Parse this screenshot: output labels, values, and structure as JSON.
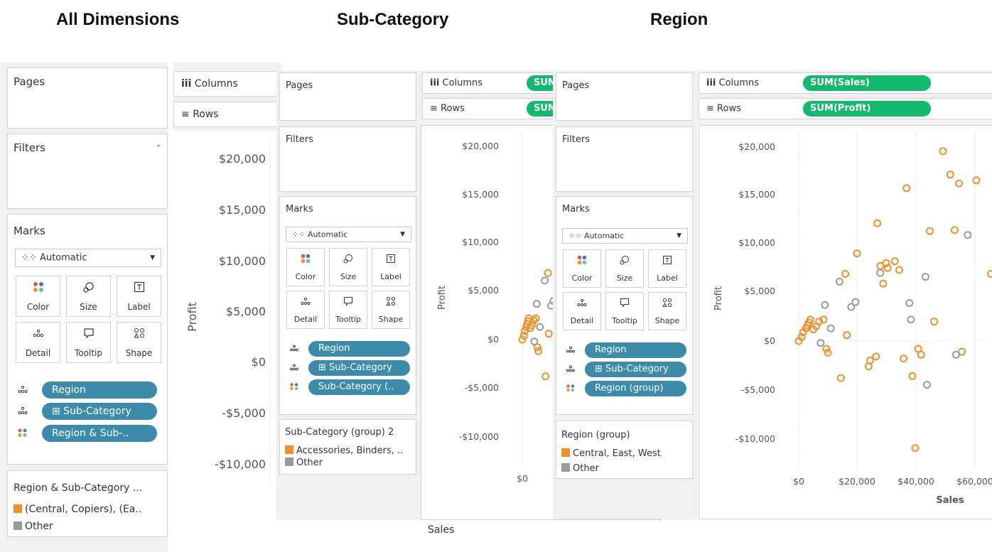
{
  "headings": {
    "all": "All Dimensions",
    "sub": "Sub-Category",
    "region": "Region"
  },
  "shelf_labels": {
    "pages": "Pages",
    "filters": "Filters",
    "marks": "Marks",
    "columns": "Columns",
    "rows": "Rows"
  },
  "columns_pill": "SUM(Sales)",
  "rows_pill": "SUM(Profit)",
  "marks_type": "Automatic",
  "mark_buttons": [
    "Color",
    "Size",
    "Label",
    "Detail",
    "Tooltip",
    "Shape"
  ],
  "colors": {
    "orange": "#f28e2b",
    "gray": "#9a9a9a",
    "pill_blue": "#3c8bab",
    "pill_green": "#13b96c"
  },
  "panel1": {
    "pills": [
      "Region",
      "⊞ Sub-Category",
      "Region & Sub-.."
    ],
    "legend_title": "Region & Sub-Category ...",
    "legend_items": [
      "(Central, Copiers), (Ea..",
      "Other"
    ]
  },
  "panel2": {
    "pills": [
      "Region",
      "⊞ Sub-Category",
      "Sub-Category (.."
    ],
    "legend_title": "Sub-Category (group) 2",
    "legend_items": [
      "Accessories, Binders, ..",
      "Other"
    ]
  },
  "panel3": {
    "pills": [
      "Region",
      "⊞ Sub-Category",
      "Region (group)"
    ],
    "legend_title": "Region (group)",
    "legend_items": [
      "Central, East, West",
      "Other"
    ]
  },
  "y_ticks": [
    "$20,000",
    "$15,000",
    "$10,000",
    "$5,000",
    "$0",
    "-$5,000",
    "-$10,000"
  ],
  "x_ticks": [
    "$0",
    "$20,000",
    "$40,000",
    "$60,000"
  ],
  "chart_data": [
    {
      "type": "scatter",
      "title": "",
      "xlabel": "Sales",
      "ylabel": "Profit",
      "xlim": [
        -4000,
        66000
      ],
      "ylim": [
        -13000,
        21000
      ],
      "series": [
        {
          "name": "Central, East, West",
          "color": "#f28e2b",
          "points": [
            [
              0,
              0
            ],
            [
              1000,
              400
            ],
            [
              1500,
              900
            ],
            [
              2500,
              1300
            ],
            [
              3000,
              1600
            ],
            [
              3500,
              1900
            ],
            [
              4000,
              2200
            ],
            [
              5000,
              1200
            ],
            [
              6000,
              1500
            ],
            [
              7000,
              2000
            ],
            [
              8500,
              2200
            ],
            [
              9500,
              -800
            ],
            [
              10000,
              -1200
            ],
            [
              14500,
              -3800
            ],
            [
              16000,
              6900
            ],
            [
              16500,
              600
            ],
            [
              20000,
              9000
            ],
            [
              24000,
              -2600
            ],
            [
              24500,
              -2000
            ],
            [
              26500,
              -1600
            ],
            [
              27000,
              12100
            ],
            [
              28000,
              7700
            ],
            [
              29000,
              5900
            ],
            [
              30000,
              8000
            ],
            [
              30500,
              7500
            ],
            [
              33000,
              8200
            ],
            [
              34500,
              7300
            ],
            [
              36000,
              -1800
            ],
            [
              37000,
              15700
            ],
            [
              39000,
              -3600
            ],
            [
              40000,
              -11000
            ],
            [
              41000,
              -800
            ],
            [
              42000,
              -1400
            ],
            [
              45000,
              11300
            ],
            [
              46500,
              2000
            ],
            [
              49500,
              19500
            ],
            [
              52000,
              17100
            ],
            [
              53500,
              11400
            ],
            [
              55000,
              16200
            ],
            [
              56000,
              -1100
            ],
            [
              61000,
              16500
            ],
            [
              66000,
              6900
            ]
          ]
        },
        {
          "name": "Other",
          "color": "#9a9a9a",
          "points": [
            [
              7500,
              -200
            ],
            [
              9000,
              3700
            ],
            [
              11000,
              1300
            ],
            [
              14000,
              6100
            ],
            [
              18000,
              3500
            ],
            [
              19500,
              4000
            ],
            [
              28000,
              7000
            ],
            [
              38000,
              3900
            ],
            [
              38500,
              2200
            ],
            [
              43500,
              6600
            ],
            [
              44000,
              -4500
            ],
            [
              54000,
              -1400
            ],
            [
              58000,
              10900
            ]
          ]
        }
      ]
    }
  ]
}
